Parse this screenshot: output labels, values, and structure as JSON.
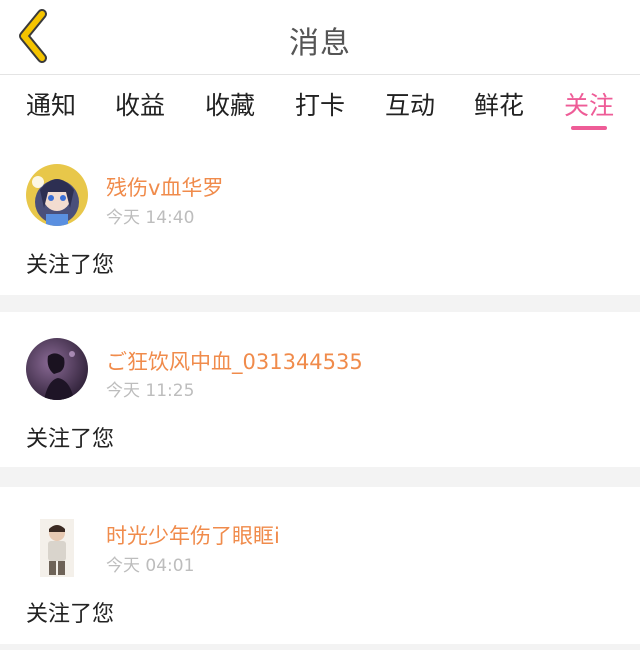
{
  "header": {
    "title": "消息",
    "back_icon": "chevron-left-icon",
    "accent": "#f5c400"
  },
  "tabs": [
    {
      "label": "通知",
      "active": false
    },
    {
      "label": "收益",
      "active": false
    },
    {
      "label": "收藏",
      "active": false
    },
    {
      "label": "打卡",
      "active": false
    },
    {
      "label": "互动",
      "active": false
    },
    {
      "label": "鲜花",
      "active": false
    },
    {
      "label": "关注",
      "active": true
    }
  ],
  "active_color": "#ee5c97",
  "username_color": "#f08b4b",
  "notifications": [
    {
      "username": "残伤v血华罗",
      "time": "今天 14:40",
      "message": "关注了您"
    },
    {
      "username": "ご狂饮风中血_031344535",
      "time": "今天 11:25",
      "message": "关注了您"
    },
    {
      "username": "时光少年伤了眼眶i",
      "time": "今天 04:01",
      "message": "关注了您"
    }
  ]
}
